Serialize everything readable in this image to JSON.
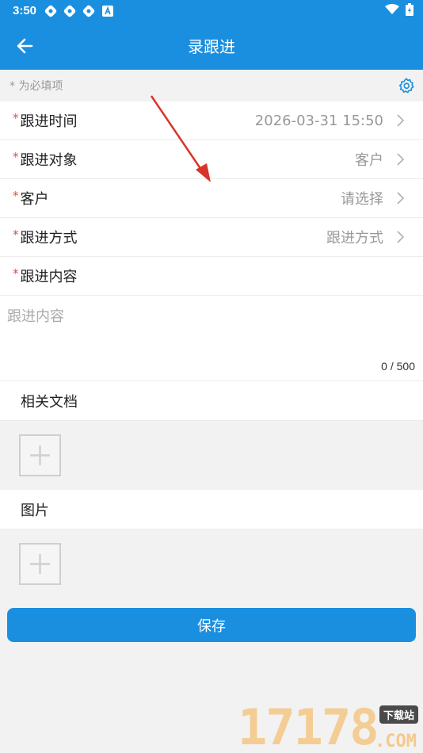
{
  "status_bar": {
    "time": "3:50",
    "notif_icons": [
      "sync-icon",
      "sync-icon",
      "sync-icon",
      "a-icon"
    ]
  },
  "app_bar": {
    "title": "录跟进"
  },
  "hint": {
    "required_note": "* 为必填项"
  },
  "form": {
    "required_mark": "*",
    "rows": [
      {
        "label": "跟进时间",
        "value": "2026-03-31 15:50"
      },
      {
        "label": "跟进对象",
        "value": "客户"
      },
      {
        "label": "客户",
        "value": "请选择"
      },
      {
        "label": "跟进方式",
        "value": "跟进方式"
      }
    ],
    "content_label": "跟进内容",
    "content_placeholder": "跟进内容",
    "content_counter": "0 / 500"
  },
  "sections": {
    "documents": "相关文档",
    "images": "图片"
  },
  "save_button": {
    "label": "保存"
  },
  "watermark": {
    "digits": "17178",
    "tag": "下载站",
    "suffix": ".COM"
  },
  "colors": {
    "primary": "#1a8fe0",
    "required": "#e64a3b",
    "annotation_arrow": "#d9342b"
  }
}
